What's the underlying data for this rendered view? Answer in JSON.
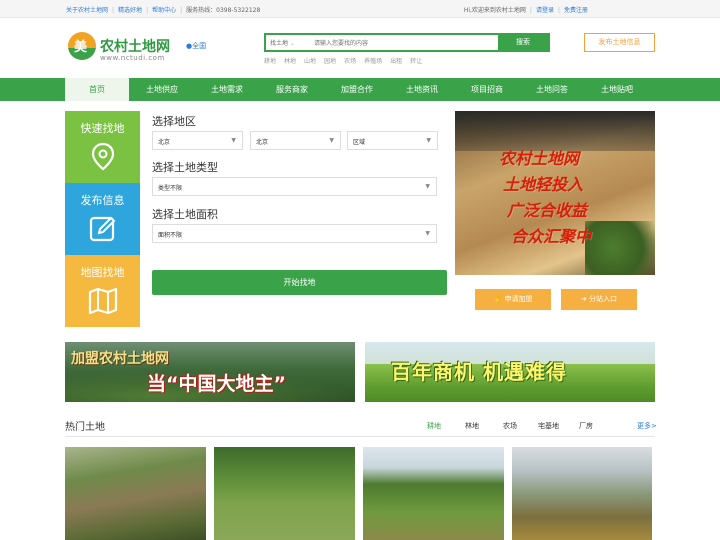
{
  "topbar": {
    "links": [
      "关于农村土地网",
      "精选好地",
      "帮助中心"
    ],
    "hotline_label": "服务热线：0398-5322128",
    "welcome": "Hi,欢迎来到农村土地网",
    "login": "请登录",
    "register": "免费注册"
  },
  "header": {
    "logo_char": "美",
    "site_name": "农村土地网",
    "site_url": "www.nctudi.com",
    "region": "全国",
    "search_type": "找土地",
    "search_placeholder": "请输入您要找的内容",
    "search_button": "搜索",
    "hot_words": [
      "耕地",
      "林地",
      "山地",
      "园地",
      "农场",
      "养殖场",
      "出租",
      "转让"
    ],
    "publish_button": "发布土地信息"
  },
  "nav": {
    "items": [
      "首页",
      "土地供应",
      "土地需求",
      "服务商家",
      "加盟合作",
      "土地资讯",
      "项目招商",
      "土地问答",
      "土地贴吧"
    ],
    "active_index": 0
  },
  "quick": {
    "tiles": [
      {
        "label": "快速找地",
        "icon": "map-pin-icon",
        "color": "#7cc242"
      },
      {
        "label": "发布信息",
        "icon": "edit-icon",
        "color": "#2fa5dd"
      },
      {
        "label": "地图找地",
        "icon": "map-icon",
        "color": "#f5b93f"
      }
    ]
  },
  "filter": {
    "region_label": "选择地区",
    "province": "北京",
    "city": "北京",
    "district": "区域",
    "type_label": "选择土地类型",
    "type_value": "类型不限",
    "area_label": "选择土地面积",
    "area_value": "面积不限",
    "start_button": "开始找地"
  },
  "promo": {
    "lines": [
      "农村土地网",
      "土地轻投入",
      "广泛合收益",
      "合众汇聚中"
    ],
    "join_button": "申请加盟",
    "branch_button": "分站入口"
  },
  "banners": {
    "left_line1": "加盟农村土地网",
    "left_line2": "当“中国大地主”",
    "right_text": "百年商机  机遇难得"
  },
  "hot_land": {
    "title": "热门土地",
    "tabs": [
      "耕地",
      "林地",
      "农场",
      "宅基地",
      "厂房"
    ],
    "active_tab": 0,
    "more": "更多>"
  },
  "colors": {
    "brand_green": "#3aa34a",
    "accent_orange": "#f5a03a",
    "link_blue": "#2d7bd6"
  }
}
